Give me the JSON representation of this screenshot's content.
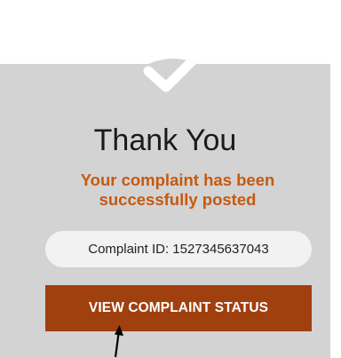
{
  "dialog": {
    "title": "Thank You",
    "message_line1": "Your complaint has been",
    "message_line2": "successfully posted",
    "complaint_id_text": "Complaint ID: 1527345637043",
    "button_label": "VIEW COMPLAINT STATUS"
  },
  "icons": {
    "badge": "checkmark-icon",
    "pointer": "arrow-pointer-icon"
  },
  "colors": {
    "card_background": "#d3d3d3",
    "message_text": "#c55a11",
    "button_background": "#a0400f",
    "button_text": "#ffffff",
    "id_pill_background": "#f2f2f2"
  }
}
